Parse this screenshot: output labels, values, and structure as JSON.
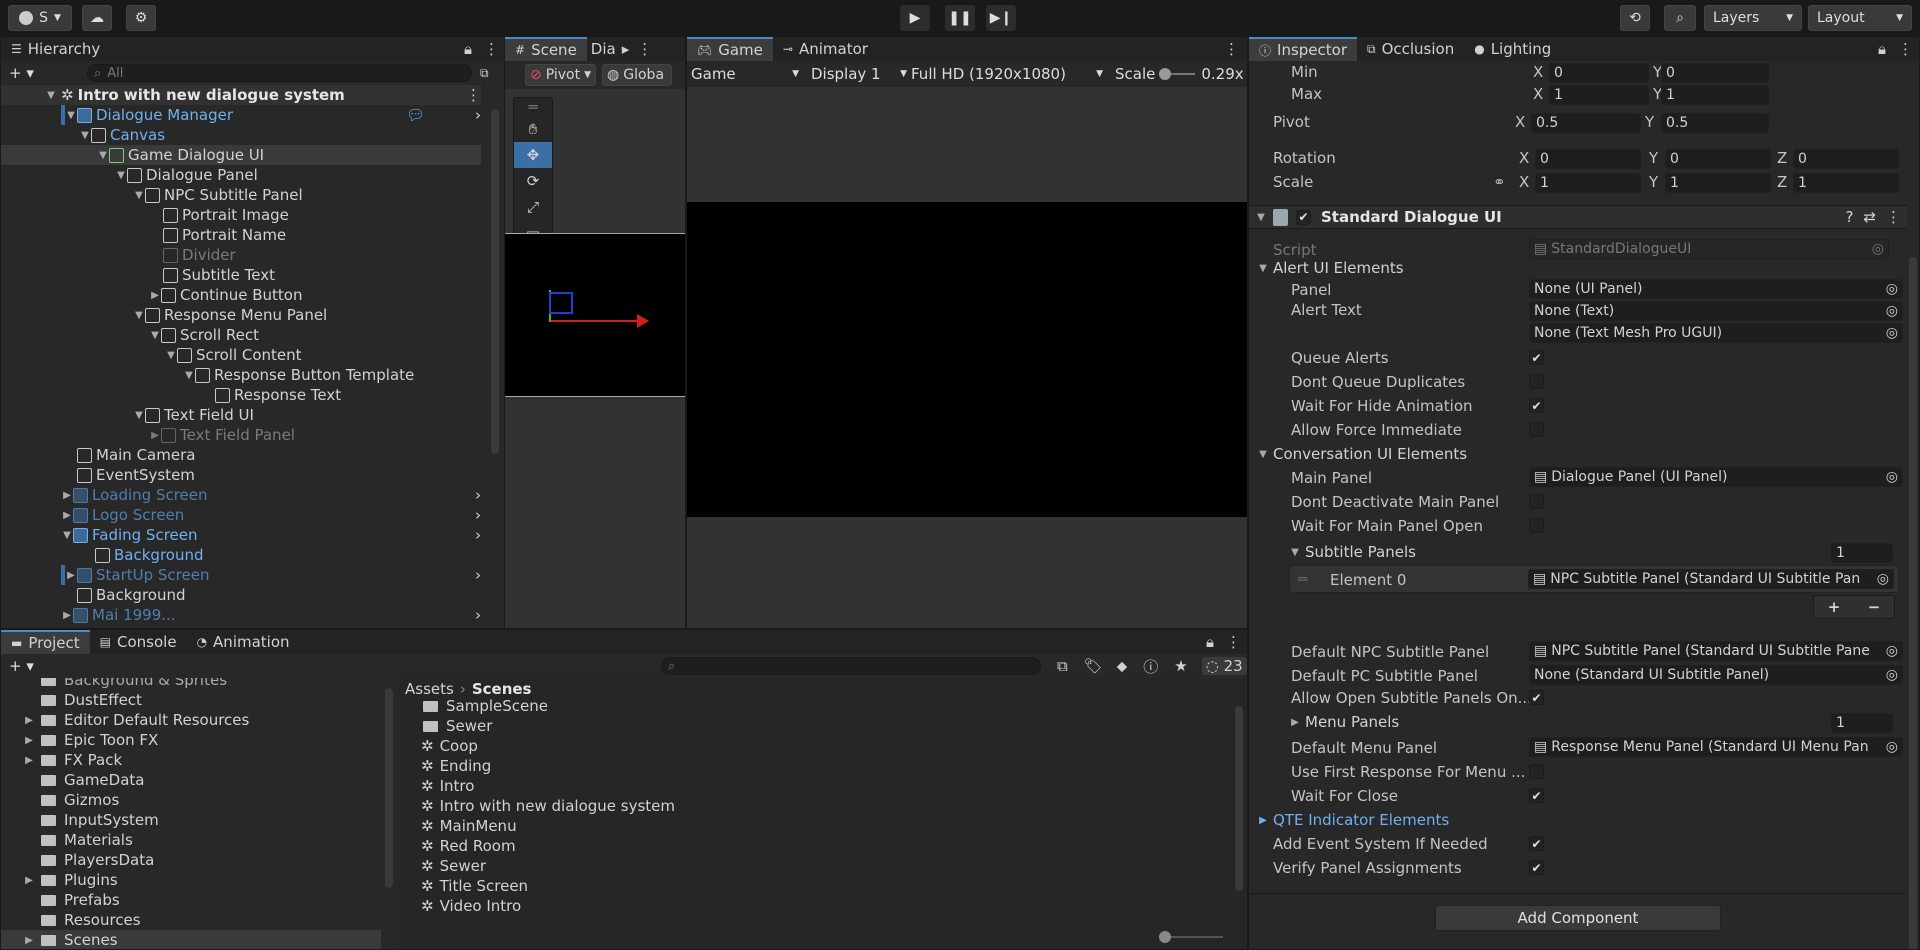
{
  "toolbar": {
    "account_label": "S",
    "layers_label": "Layers",
    "layout_label": "Layout"
  },
  "hierarchy": {
    "tab_label": "Hierarchy",
    "search_placeholder": "All",
    "scene_name": "Intro with new dialogue system",
    "items": [
      {
        "label": "Dialogue Manager"
      },
      {
        "label": "Canvas"
      },
      {
        "label": "Game Dialogue UI"
      },
      {
        "label": "Dialogue Panel"
      },
      {
        "label": "NPC Subtitle Panel"
      },
      {
        "label": "Portrait Image"
      },
      {
        "label": "Portrait Name"
      },
      {
        "label": "Divider"
      },
      {
        "label": "Subtitle Text"
      },
      {
        "label": "Continue Button"
      },
      {
        "label": "Response Menu Panel"
      },
      {
        "label": "Scroll Rect"
      },
      {
        "label": "Scroll Content"
      },
      {
        "label": "Response Button Template"
      },
      {
        "label": "Response Text"
      },
      {
        "label": "Text Field UI"
      },
      {
        "label": "Text Field Panel"
      },
      {
        "label": "Main Camera"
      },
      {
        "label": "EventSystem"
      },
      {
        "label": "Loading Screen"
      },
      {
        "label": "Logo Screen"
      },
      {
        "label": "Fading Screen"
      },
      {
        "label": "Background"
      },
      {
        "label": "StartUp Screen"
      },
      {
        "label": "Background"
      },
      {
        "label": "Mai 1999..."
      }
    ]
  },
  "scene": {
    "tab_scene": "Scene",
    "tab_dia": "Dia",
    "pivot_label": "Pivot",
    "global_label": "Globa"
  },
  "game": {
    "tab_game": "Game",
    "tab_animator": "Animator",
    "display_mode": "Game",
    "display": "Display 1",
    "resolution": "Full HD (1920x1080)",
    "scale_label": "Scale",
    "scale_value": "0.29x"
  },
  "inspector": {
    "tab_inspector": "Inspector",
    "tab_occlusion": "Occlusion",
    "tab_lighting": "Lighting",
    "min_label": "Min",
    "min_x": "0",
    "min_y": "0",
    "max_label": "Max",
    "max_x": "1",
    "max_y": "1",
    "pivot_label": "Pivot",
    "pivot_x": "0.5",
    "pivot_y": "0.5",
    "rotation_label": "Rotation",
    "rot_x": "0",
    "rot_y": "0",
    "rot_z": "0",
    "scale_label": "Scale",
    "scale_x": "1",
    "scale_y": "1",
    "scale_z": "1",
    "axis_x": "X",
    "axis_y": "Y",
    "axis_z": "Z",
    "component_title": "Standard Dialogue UI",
    "script_label": "Script",
    "script_value": "StandardDialogueUI",
    "alert_section": "Alert UI Elements",
    "panel_label": "Panel",
    "panel_value": "None (UI Panel)",
    "alert_text_label": "Alert Text",
    "alert_text_value": "None (Text)",
    "alert_tmp_value": "None (Text Mesh Pro UGUI)",
    "queue_alerts": "Queue Alerts",
    "dont_queue_dupes": "Dont Queue Duplicates",
    "wait_hide_anim": "Wait For Hide Animation",
    "allow_force": "Allow Force Immediate",
    "conversation_section": "Conversation UI Elements",
    "main_panel_label": "Main Panel",
    "main_panel_value": "Dialogue Panel (UI Panel)",
    "dont_deactivate": "Dont Deactivate Main Panel",
    "wait_main_open": "Wait For Main Panel Open",
    "subtitle_panels": "Subtitle Panels",
    "subtitle_panels_count": "1",
    "element0_label": "Element 0",
    "element0_value": "NPC Subtitle Panel (Standard UI Subtitle Pan",
    "add_label": "+",
    "remove_label": "−",
    "default_npc_label": "Default NPC Subtitle Panel",
    "default_npc_value": "NPC Subtitle Panel (Standard UI Subtitle Pane",
    "default_pc_label": "Default PC Subtitle Panel",
    "default_pc_value": "None (Standard UI Subtitle Panel)",
    "allow_open_subtitle": "Allow Open Subtitle Panels On...",
    "menu_panels": "Menu Panels",
    "menu_panels_count": "1",
    "default_menu_label": "Default Menu Panel",
    "default_menu_value": "Response Menu Panel (Standard UI Menu Pan",
    "use_first_response": "Use First Response For Menu ...",
    "wait_for_close": "Wait For Close",
    "qte_section": "QTE Indicator Elements",
    "add_event_system": "Add Event System If Needed",
    "verify_panels": "Verify Panel Assignments",
    "add_component": "Add Component"
  },
  "project": {
    "tab_project": "Project",
    "tab_console": "Console",
    "tab_animation": "Animation",
    "hidden_count": "23",
    "breadcrumb_root": "Assets",
    "breadcrumb_current": "Scenes",
    "folders": [
      {
        "label": "Background & Sprites"
      },
      {
        "label": "DustEffect"
      },
      {
        "label": "Editor Default Resources"
      },
      {
        "label": "Epic Toon FX"
      },
      {
        "label": "FX Pack"
      },
      {
        "label": "GameData"
      },
      {
        "label": "Gizmos"
      },
      {
        "label": "InputSystem"
      },
      {
        "label": "Materials"
      },
      {
        "label": "PlayersData"
      },
      {
        "label": "Plugins"
      },
      {
        "label": "Prefabs"
      },
      {
        "label": "Resources"
      },
      {
        "label": "Scenes"
      }
    ],
    "assets": [
      {
        "label": "SampleScene"
      },
      {
        "label": "Sewer"
      },
      {
        "label": "Coop"
      },
      {
        "label": "Ending"
      },
      {
        "label": "Intro"
      },
      {
        "label": "Intro with new dialogue system"
      },
      {
        "label": "MainMenu"
      },
      {
        "label": "Red Room"
      },
      {
        "label": "Sewer"
      },
      {
        "label": "Title Screen"
      },
      {
        "label": "Video Intro"
      }
    ]
  }
}
